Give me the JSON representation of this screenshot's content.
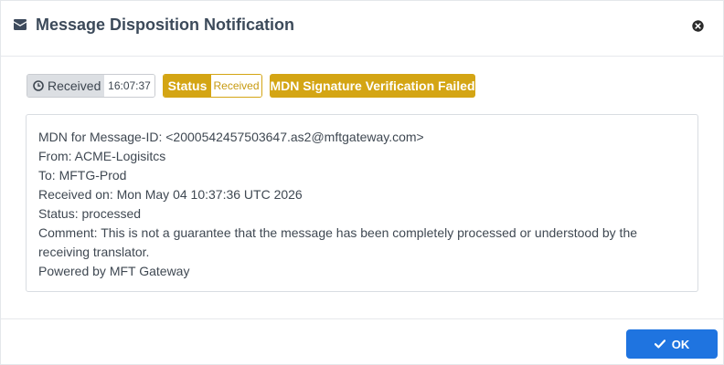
{
  "header": {
    "title": "Message Disposition Notification",
    "icon": "envelope-icon",
    "close_icon": "close-circle-icon"
  },
  "badges": {
    "received_label": "Received",
    "received_time": "16:07:37",
    "status_label": "Status",
    "status_value": "Received",
    "mdn_failure": "MDN Signature Verification Failed"
  },
  "message": {
    "lines": [
      "MDN for Message-ID: <2000542457503647.as2@mftgateway.com>",
      "From: ACME-Logisitcs",
      "To: MFTG-Prod",
      "Received on: Mon May 04 10:37:36 UTC 2026",
      "Status: processed",
      "Comment: This is not a guarantee that the message has been completely processed or understood by the",
      "receiving translator.",
      "Powered by MFT Gateway"
    ]
  },
  "footer": {
    "ok_label": "OK",
    "ok_icon": "check-icon"
  },
  "colors": {
    "accent_gold": "#d4a514",
    "primary_blue": "#1f74e0",
    "title_text": "#3c4a5a"
  }
}
